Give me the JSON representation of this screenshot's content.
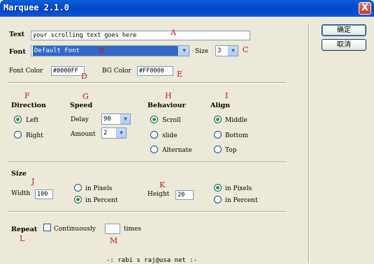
{
  "window": {
    "title": "Marquee 2.1.0",
    "close_label": "X"
  },
  "buttons": {
    "ok": "确定",
    "cancel": "取消"
  },
  "text_row": {
    "label": "Text",
    "value": "your scrolling text goes here"
  },
  "font_row": {
    "label": "Font",
    "font_value": "Default Font",
    "size_label": "Size",
    "size_value": "3"
  },
  "colors": {
    "font_color_label": "Font Color",
    "font_color_value": "#0000FF",
    "bg_color_label": "BG Color",
    "bg_color_value": "#FF0000"
  },
  "direction": {
    "label": "Direction",
    "options": [
      {
        "label": "Left",
        "selected": true
      },
      {
        "label": "Right",
        "selected": false
      }
    ]
  },
  "speed": {
    "label": "Speed",
    "delay_label": "Delay",
    "delay_value": "90",
    "amount_label": "Amount",
    "amount_value": "2"
  },
  "behaviour": {
    "label": "Behaviour",
    "options": [
      {
        "label": "Scroll",
        "selected": true
      },
      {
        "label": "slide",
        "selected": false
      },
      {
        "label": "Alternate",
        "selected": false
      }
    ]
  },
  "align": {
    "label": "Align",
    "options": [
      {
        "label": "Middle",
        "selected": true
      },
      {
        "label": "Bottom",
        "selected": false
      },
      {
        "label": "Top",
        "selected": false
      }
    ]
  },
  "size": {
    "label": "Size",
    "width_label": "Width",
    "width_value": "100",
    "width_units": [
      {
        "label": "in Pixels",
        "selected": false
      },
      {
        "label": "in Percent",
        "selected": true
      }
    ],
    "height_label": "Height",
    "height_value": "20",
    "height_units": [
      {
        "label": "in Pixels",
        "selected": true
      },
      {
        "label": "in Percent",
        "selected": false
      }
    ]
  },
  "repeat": {
    "label": "Repeat",
    "continuously_label": "Continuously",
    "continuously_checked": false,
    "times_value": "",
    "times_label": "times"
  },
  "footer": {
    "credit": "-: rabi s raj@usa net :-"
  },
  "annotations": {
    "A": "A",
    "B": "B",
    "C": "C",
    "D": "D",
    "E": "E",
    "F": "F",
    "G": "G",
    "H": "H",
    "I": "I",
    "J": "J",
    "K": "K",
    "L": "L",
    "M": "M"
  },
  "theme": {
    "dialog_bg": "#ece9d8",
    "titlebar": "#0046c9",
    "selection": "#316ac5",
    "radio_dot": "#21a121",
    "annotation_red": "#c01818"
  }
}
